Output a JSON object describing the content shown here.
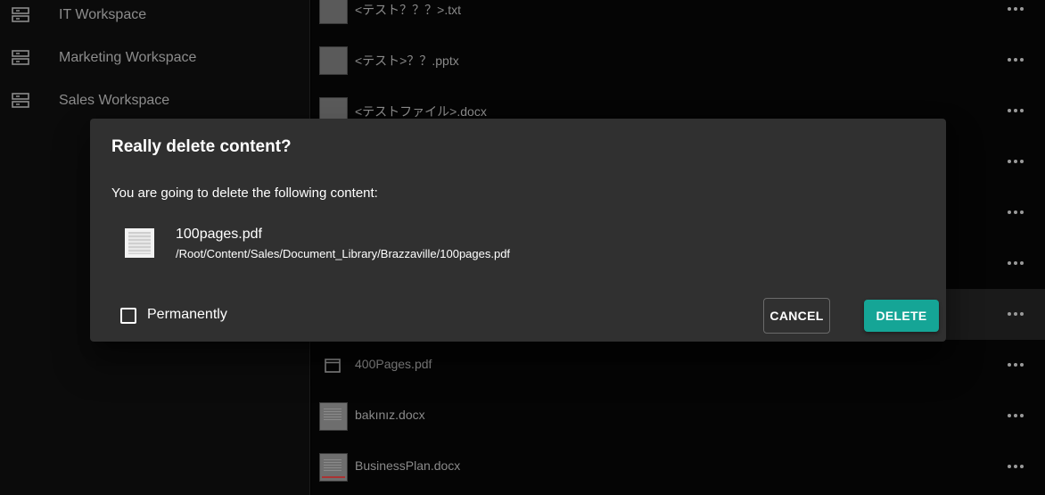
{
  "sidebar": {
    "workspaces": [
      {
        "label": "IT Workspace",
        "icon": "workspace-icon"
      },
      {
        "label": "Marketing Workspace",
        "icon": "workspace-icon"
      },
      {
        "label": "Sales Workspace",
        "icon": "workspace-icon"
      }
    ]
  },
  "files": [
    {
      "name": "<テスト？？？>.txt"
    },
    {
      "name": "<テスト>？？.pptx"
    },
    {
      "name": "<テストファイル>.docx"
    },
    {
      "name": "400Pages.pdf"
    },
    {
      "name": "bakınız.docx"
    },
    {
      "name": "BusinessPlan.docx"
    }
  ],
  "dialog": {
    "title": "Really delete content?",
    "message": "You are going to delete the following content:",
    "item_name": "100pages.pdf",
    "item_path": "/Root/Content/Sales/Document_Library/Brazzaville/100pages.pdf",
    "permanently_label": "Permanently",
    "permanently_checked": false,
    "cancel_label": "CANCEL",
    "delete_label": "DELETE"
  },
  "colors": {
    "accent": "#15a596",
    "dialog_bg": "#303030",
    "page_bg": "#000000"
  }
}
